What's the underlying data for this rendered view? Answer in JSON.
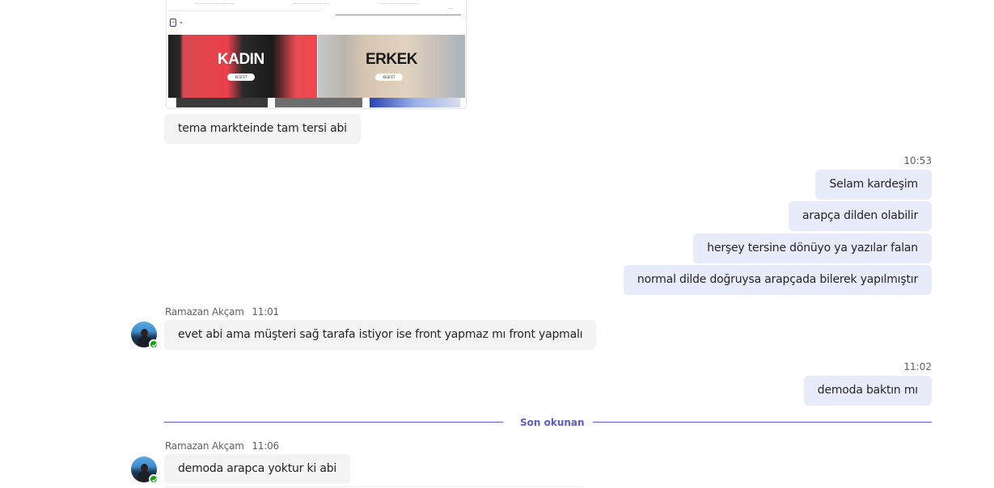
{
  "preview": {
    "banner_left_label": "KADIN",
    "banner_right_label": "ERKEK",
    "banner_button_label": "KEŞFET"
  },
  "messages": [
    {
      "sender": "",
      "time": "",
      "text": "tema markteinde tam tersi abi",
      "direction": "incoming"
    },
    {
      "sender": "",
      "time": "10:53",
      "text": "Selam kardeşim",
      "direction": "outgoing"
    },
    {
      "sender": "",
      "time": "",
      "text": "arapça dilden olabilir",
      "direction": "outgoing"
    },
    {
      "sender": "",
      "time": "",
      "text": "herşey tersine dönüyo ya yazılar falan",
      "direction": "outgoing"
    },
    {
      "sender": "",
      "time": "",
      "text": "normal dilde doğruysa arapçada bilerek yapılmıştır",
      "direction": "outgoing"
    },
    {
      "sender": "Ramazan Akçam",
      "time": "11:01",
      "text": "evet abi ama müşteri sağ tarafa istiyor ise front yapmaz mı front yapmalı",
      "direction": "incoming"
    },
    {
      "sender": "",
      "time": "11:02",
      "text": "demoda baktın mı",
      "direction": "outgoing"
    },
    {
      "sender": "Ramazan Akçam",
      "time": "11:06",
      "text": "demoda arapca yoktur ki abi",
      "direction": "incoming"
    }
  ],
  "last_read_divider": {
    "label": "Son okunan"
  },
  "colors": {
    "incoming_bubble": "#f3f3f3",
    "outgoing_bubble": "#e8ebfa",
    "accent": "#5b5fc7",
    "presence_available": "#13a10e"
  }
}
